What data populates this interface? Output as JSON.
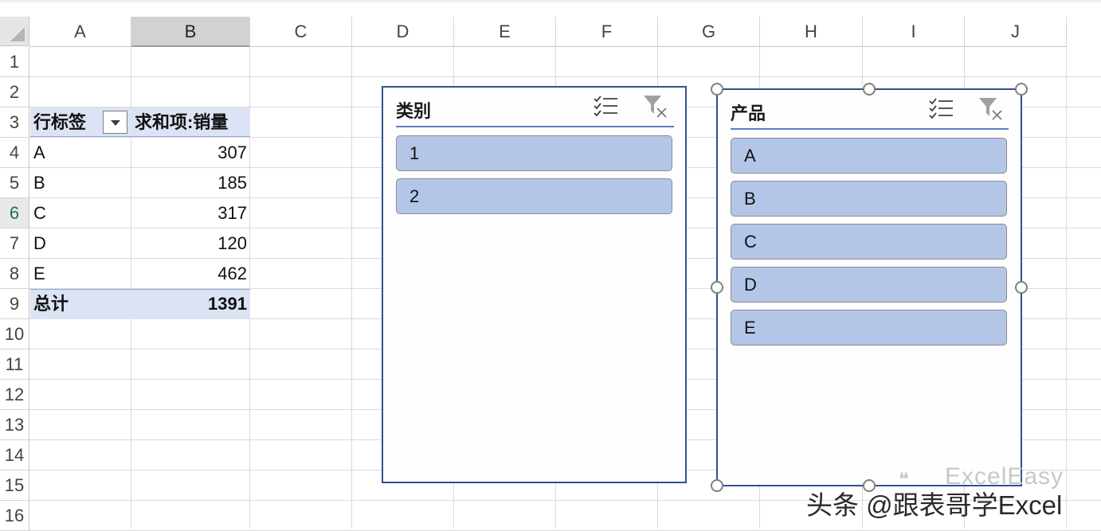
{
  "columns": [
    "A",
    "B",
    "C",
    "D",
    "E",
    "F",
    "G",
    "H",
    "I",
    "J"
  ],
  "rows": [
    "1",
    "2",
    "3",
    "4",
    "5",
    "6",
    "7",
    "8",
    "9",
    "10",
    "11",
    "12",
    "13",
    "14",
    "15",
    "16"
  ],
  "selected_column": "B",
  "selected_row": "6",
  "pivot": {
    "row_label_header": "行标签",
    "value_header": "求和项:销量",
    "rows": [
      {
        "label": "A",
        "value": "307"
      },
      {
        "label": "B",
        "value": "185"
      },
      {
        "label": "C",
        "value": "317"
      },
      {
        "label": "D",
        "value": "120"
      },
      {
        "label": "E",
        "value": "462"
      }
    ],
    "total_label": "总计",
    "total_value": "1391"
  },
  "slicer_category": {
    "title": "类别",
    "items": [
      "1",
      "2"
    ]
  },
  "slicer_product": {
    "title": "产品",
    "items": [
      "A",
      "B",
      "C",
      "D",
      "E"
    ]
  },
  "watermark": {
    "brand": "ExcelEasy",
    "credit": "头条 @跟表哥学Excel"
  },
  "colors": {
    "pivot_header_bg": "#dbe3f4",
    "slicer_item_bg": "#b4c6e7",
    "slicer_border": "#2f528f"
  },
  "icons": {
    "multi_select": "multi-select-icon",
    "clear_filter": "clear-filter-icon",
    "dropdown": "dropdown-arrow-icon"
  }
}
